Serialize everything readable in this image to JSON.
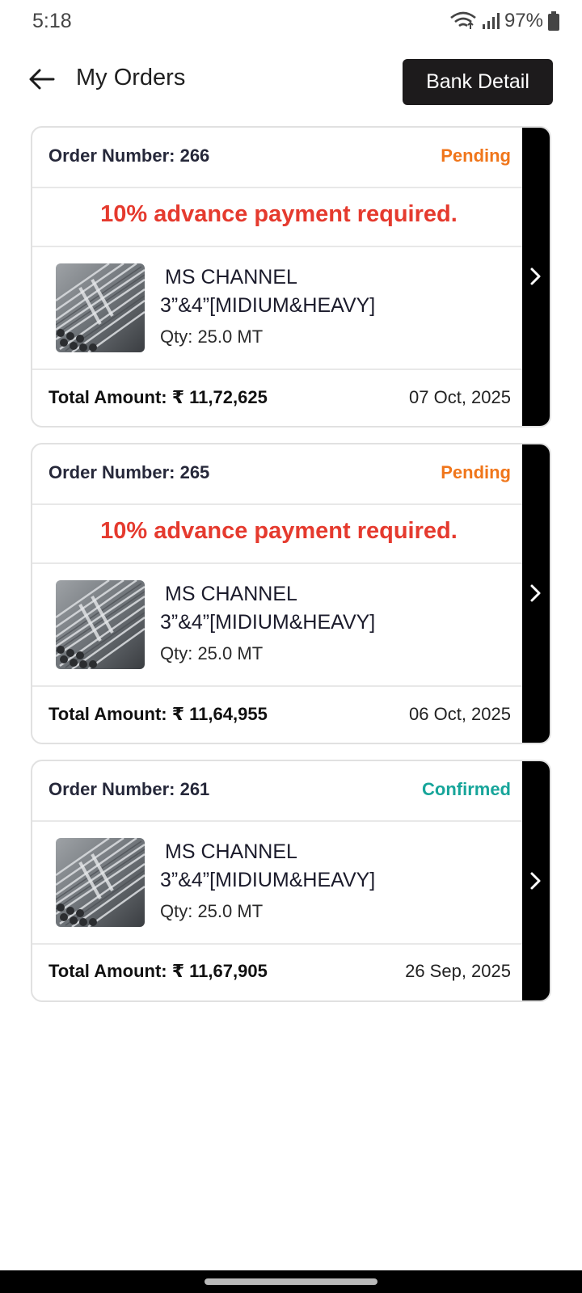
{
  "status_bar": {
    "time": "5:18",
    "battery": "97%"
  },
  "app_bar": {
    "title": "My Orders",
    "bank_detail_label": "Bank Detail"
  },
  "orders": [
    {
      "order_number": "Order Number: 266",
      "status": "Pending",
      "notice": "10% advance payment required.",
      "product_line1": "MS CHANNEL",
      "product_line2": "3”&4”[MIDIUM&HEAVY]",
      "qty": "Qty: 25.0 MT",
      "total": "Total Amount: ₹ 11,72,625",
      "date": "07 Oct, 2025"
    },
    {
      "order_number": "Order Number: 265",
      "status": "Pending",
      "notice": "10% advance payment required.",
      "product_line1": "MS CHANNEL",
      "product_line2": "3”&4”[MIDIUM&HEAVY]",
      "qty": "Qty: 25.0 MT",
      "total": "Total Amount: ₹ 11,64,955",
      "date": "06 Oct, 2025"
    },
    {
      "order_number": "Order Number: 261",
      "status": "Confirmed",
      "product_line1": "MS CHANNEL",
      "product_line2": "3”&4”[MIDIUM&HEAVY]",
      "qty": "Qty: 25.0 MT",
      "total": "Total Amount: ₹ 11,67,905",
      "date": "26 Sep, 2025"
    }
  ],
  "colors": {
    "pending": "#f0761b",
    "confirmed": "#17a59a",
    "notice": "#e53a2e",
    "button": "#1d1b1c"
  }
}
